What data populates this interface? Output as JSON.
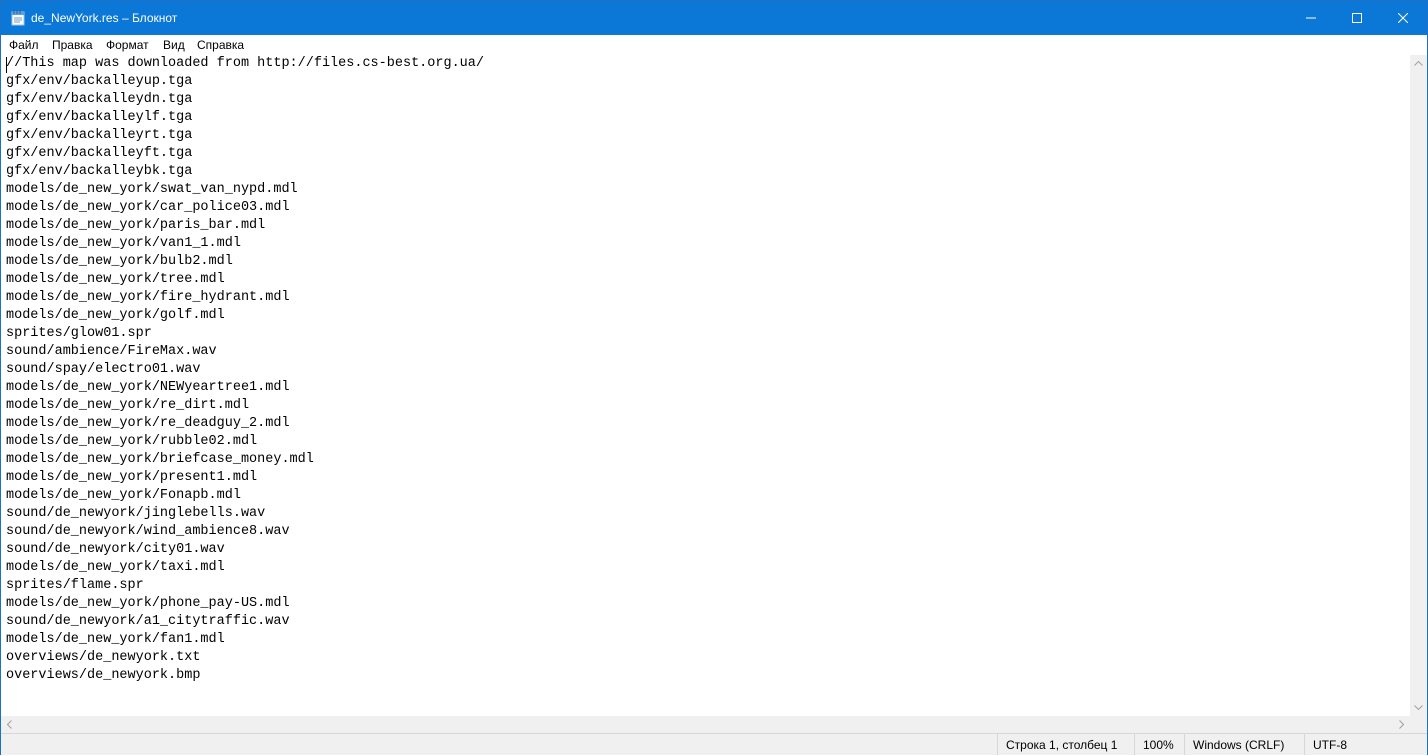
{
  "window": {
    "title": "de_NewYork.res – Блокнот",
    "caption_buttons": [
      "minimize",
      "maximize",
      "close"
    ]
  },
  "menu": {
    "items": [
      "Файл",
      "Правка",
      "Формат",
      "Вид",
      "Справка"
    ]
  },
  "editor": {
    "lines": [
      "//This map was downloaded from http://files.cs-best.org.ua/",
      "gfx/env/backalleyup.tga",
      "gfx/env/backalleydn.tga",
      "gfx/env/backalleylf.tga",
      "gfx/env/backalleyrt.tga",
      "gfx/env/backalleyft.tga",
      "gfx/env/backalleybk.tga",
      "models/de_new_york/swat_van_nypd.mdl",
      "models/de_new_york/car_police03.mdl",
      "models/de_new_york/paris_bar.mdl",
      "models/de_new_york/van1_1.mdl",
      "models/de_new_york/bulb2.mdl",
      "models/de_new_york/tree.mdl",
      "models/de_new_york/fire_hydrant.mdl",
      "models/de_new_york/golf.mdl",
      "sprites/glow01.spr",
      "sound/ambience/FireMax.wav",
      "sound/spay/electro01.wav",
      "models/de_new_york/NEWyeartree1.mdl",
      "models/de_new_york/re_dirt.mdl",
      "models/de_new_york/re_deadguy_2.mdl",
      "models/de_new_york/rubble02.mdl",
      "models/de_new_york/briefcase_money.mdl",
      "models/de_new_york/present1.mdl",
      "models/de_new_york/Fonapb.mdl",
      "sound/de_newyork/jinglebells.wav",
      "sound/de_newyork/wind_ambience8.wav",
      "sound/de_newyork/city01.wav",
      "models/de_new_york/taxi.mdl",
      "sprites/flame.spr",
      "models/de_new_york/phone_pay-US.mdl",
      "sound/de_newyork/a1_citytraffic.wav",
      "models/de_new_york/fan1.mdl",
      "overviews/de_newyork.txt",
      "overviews/de_newyork.bmp"
    ]
  },
  "status": {
    "position": "Строка 1, столбец 1",
    "zoom": "100%",
    "line_endings": "Windows (CRLF)",
    "encoding": "UTF-8"
  },
  "colors": {
    "titlebar": "#0b78d7",
    "statusbar": "#f0f0f0"
  }
}
